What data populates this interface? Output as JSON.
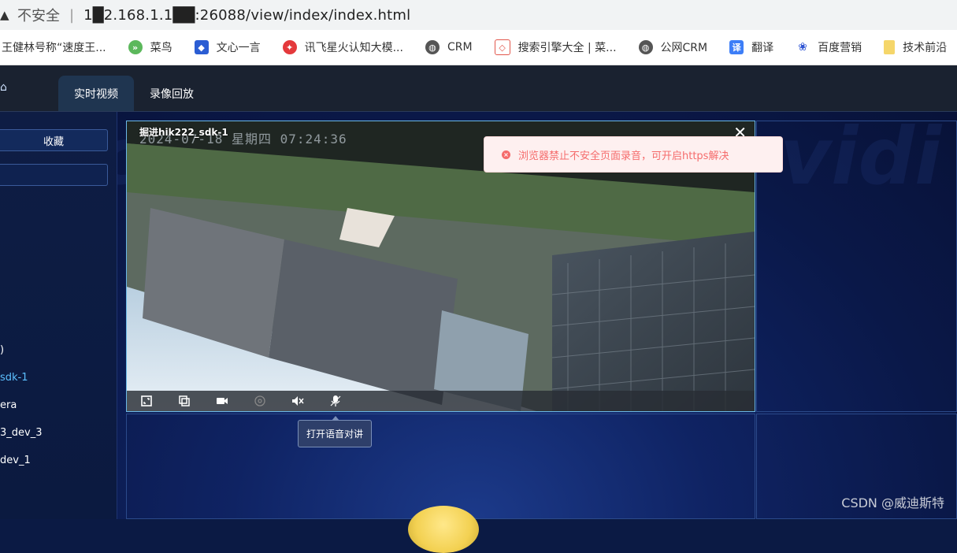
{
  "browser": {
    "insecure_label": "不安全",
    "url": "1█2.168.1.1██:26088/view/index/index.html"
  },
  "bookmarks": [
    {
      "label": "王健林号称“速度王...",
      "icon": "none",
      "color": "#ffffff"
    },
    {
      "label": "菜鸟",
      "icon": "runoob-icon",
      "color": "#5cb85c"
    },
    {
      "label": "文心一言",
      "icon": "wenxin-icon",
      "color": "#2b5dd3"
    },
    {
      "label": "讯飞星火认知大模...",
      "icon": "xunfei-icon",
      "color": "#e4393c"
    },
    {
      "label": "CRM",
      "icon": "globe-icon",
      "color": "#555555"
    },
    {
      "label": "搜索引擎大全 | 菜...",
      "icon": "cube-icon",
      "color": "#e2574c"
    },
    {
      "label": "公网CRM",
      "icon": "globe-icon",
      "color": "#555555"
    },
    {
      "label": "翻译",
      "icon": "translate-icon",
      "color": "#3d7ef7"
    },
    {
      "label": "百度营销",
      "icon": "baidu-icon",
      "color": "#2f55d4"
    },
    {
      "label": "技术前沿",
      "icon": "folder-icon",
      "color": "#f5d66a"
    }
  ],
  "header": {
    "tabs": [
      {
        "label": "实时视频",
        "active": true
      },
      {
        "label": "录像回放",
        "active": false
      }
    ]
  },
  "sidebar": {
    "favorites_label": "收藏",
    "tree": [
      {
        "label": ")",
        "selected": false
      },
      {
        "label": "sdk-1",
        "selected": true
      },
      {
        "label": "era",
        "selected": false
      },
      {
        "label": "3_dev_3",
        "selected": false
      },
      {
        "label": "dev_1",
        "selected": false
      }
    ]
  },
  "video": {
    "camera_title": "掘进hik222_sdk-1",
    "osd_time": "2024-07-18  星期四  07:24:36",
    "close_label": "✕"
  },
  "tooltip": {
    "label": "打开语音对讲"
  },
  "toast": {
    "message": "浏览器禁止不安全页面录音，可开启https解决"
  },
  "watermark": {
    "label": "CSDN @威迪斯特"
  },
  "colors": {
    "accent": "#5cc0ff",
    "error": "#f56c6c",
    "header_bg": "#1a2230"
  }
}
